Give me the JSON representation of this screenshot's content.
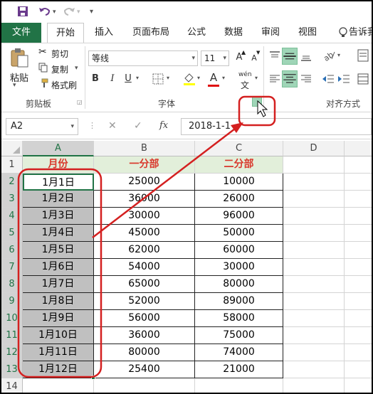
{
  "qat": {
    "save_icon": "save-icon",
    "undo_icon": "undo-icon",
    "redo_icon": "redo-icon",
    "customize_icon": "customize-icon"
  },
  "tabs": [
    {
      "label": "文件",
      "name": "tab-file"
    },
    {
      "label": "开始",
      "name": "tab-home"
    },
    {
      "label": "插入",
      "name": "tab-insert"
    },
    {
      "label": "页面布局",
      "name": "tab-page-layout"
    },
    {
      "label": "公式",
      "name": "tab-formulas"
    },
    {
      "label": "数据",
      "name": "tab-data"
    },
    {
      "label": "审阅",
      "name": "tab-review"
    },
    {
      "label": "视图",
      "name": "tab-view"
    },
    {
      "label": "告诉我",
      "name": "tab-tell-me"
    }
  ],
  "clipboard": {
    "paste": "粘贴",
    "cut": "剪切",
    "copy": "复制",
    "format_painter": "格式刷",
    "group_label": "剪贴板"
  },
  "font": {
    "family": "等线",
    "size": "11",
    "group_label": "字体",
    "bold": "B",
    "italic": "I",
    "underline": "U",
    "grow": "A",
    "shrink": "A",
    "font_color": "A",
    "phonetic_top": "wén",
    "phonetic_bottom": "文"
  },
  "alignment": {
    "group_label": "对齐方式"
  },
  "formula_bar": {
    "name_box": "A2",
    "cancel": "✕",
    "enter": "✓",
    "fx": "fx",
    "value": "2018-1-1"
  },
  "columns": [
    "A",
    "B",
    "C",
    "D"
  ],
  "rows": [
    "1",
    "2",
    "3",
    "4",
    "5",
    "6",
    "7",
    "8",
    "9",
    "10",
    "11",
    "12",
    "13",
    "14"
  ],
  "table": {
    "headers": [
      "月份",
      "一分部",
      "二分部"
    ],
    "data": [
      [
        "1月1日",
        "25000",
        "10000"
      ],
      [
        "1月2日",
        "36000",
        "26000"
      ],
      [
        "1月3日",
        "30000",
        "96000"
      ],
      [
        "1月4日",
        "45000",
        "50000"
      ],
      [
        "1月5日",
        "62000",
        "60000"
      ],
      [
        "1月6日",
        "54000",
        "30000"
      ],
      [
        "1月7日",
        "65000",
        "80000"
      ],
      [
        "1月8日",
        "52000",
        "89000"
      ],
      [
        "1月9日",
        "56000",
        "58000"
      ],
      [
        "1月10日",
        "36000",
        "75000"
      ],
      [
        "1月11日",
        "80000",
        "74000"
      ],
      [
        "1月12日",
        "25400",
        "21000"
      ]
    ]
  },
  "annotation_color": "#d42020",
  "accent_color": "#217346"
}
